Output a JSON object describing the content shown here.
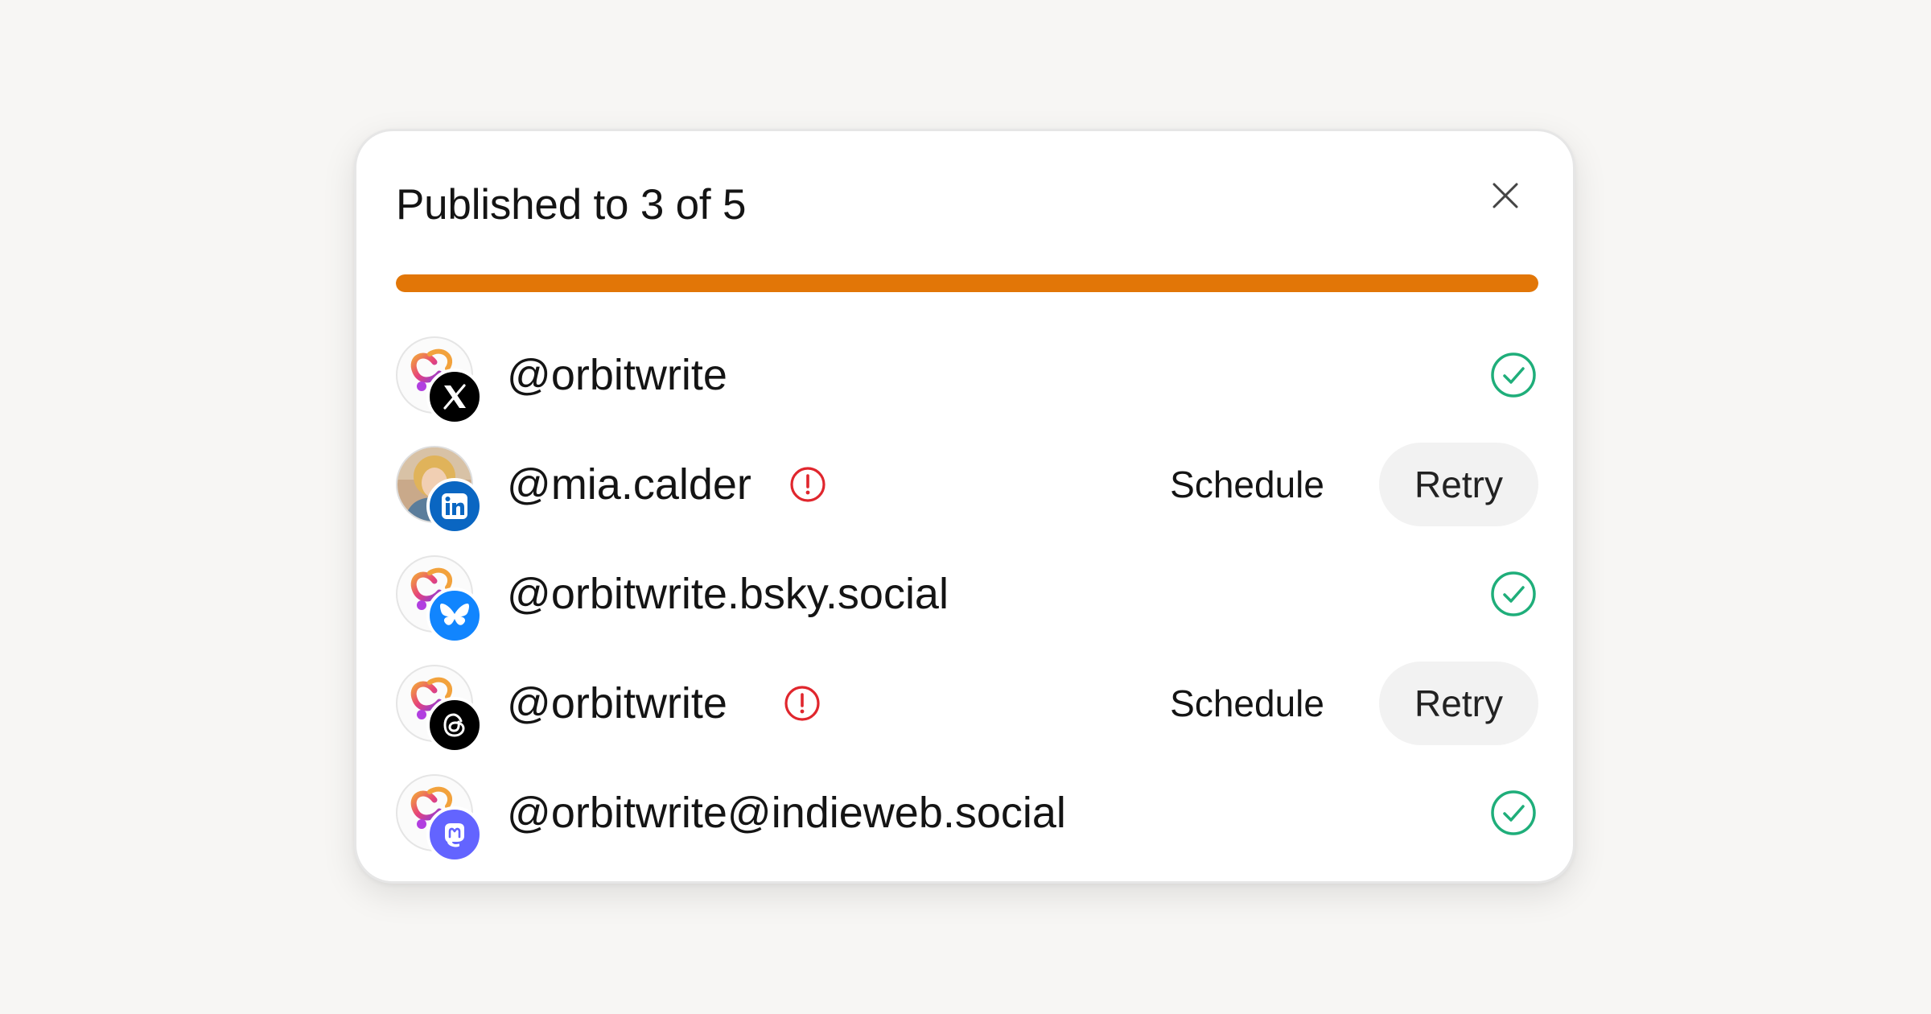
{
  "dialog": {
    "title": "Published to 3 of 5",
    "progress": {
      "fraction": 1.0,
      "color": "#e27607"
    },
    "colors": {
      "success": "#1fae7a",
      "error": "#e0262d"
    },
    "close_icon": "close-icon"
  },
  "accounts": [
    {
      "handle": "@orbitwrite",
      "platform": "x",
      "status": "success",
      "avatar": "orbitwrite-logo",
      "badge_color": "#000000"
    },
    {
      "handle": "@mia.calder",
      "platform": "linkedin",
      "status": "error",
      "avatar": "user-photo",
      "badge_color": "#0a66c2",
      "schedule_label": "Schedule",
      "retry_label": "Retry"
    },
    {
      "handle": "@orbitwrite.bsky.social",
      "platform": "bluesky",
      "status": "success",
      "avatar": "orbitwrite-logo",
      "badge_color": "#1185fe"
    },
    {
      "handle": "@orbitwrite",
      "platform": "threads",
      "status": "error",
      "avatar": "orbitwrite-logo",
      "badge_color": "#000000",
      "schedule_label": "Schedule",
      "retry_label": "Retry"
    },
    {
      "handle": "@orbitwrite@indieweb.social",
      "platform": "mastodon",
      "status": "success",
      "avatar": "orbitwrite-logo",
      "badge_color": "#6364ff"
    }
  ]
}
